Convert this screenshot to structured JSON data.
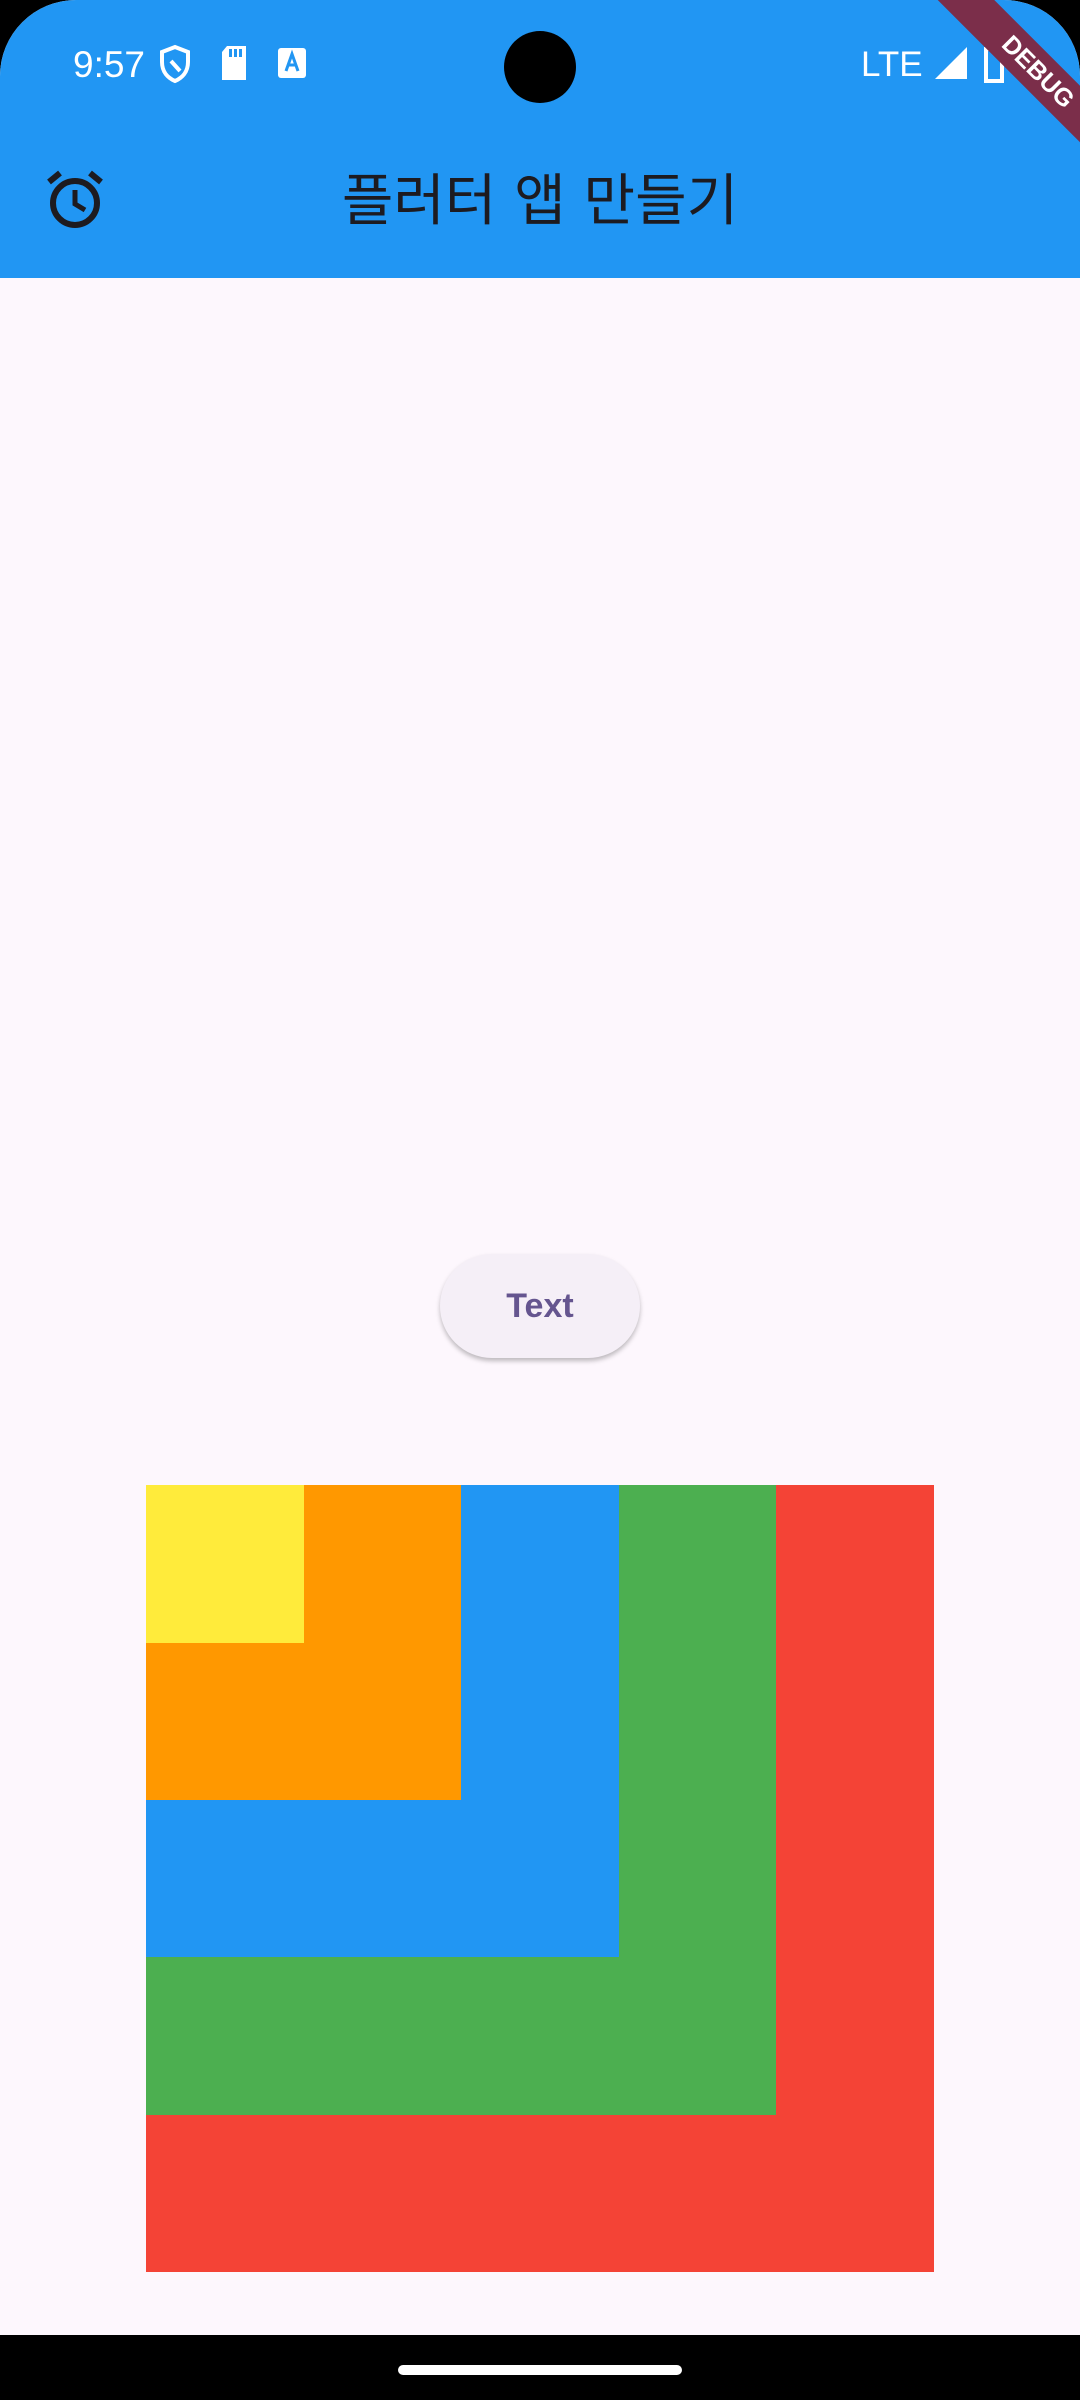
{
  "status_bar": {
    "time": "9:57",
    "network": "LTE",
    "icons": [
      "shield-icon",
      "sd-card-icon",
      "a-notification-icon",
      "signal-icon",
      "battery-icon"
    ]
  },
  "debug_banner": "DEBUG",
  "app_bar": {
    "title": "플러터 앱 만들기",
    "leading_icon": "alarm-icon",
    "color": "#2196f3"
  },
  "button": {
    "label": "Text",
    "text_color": "#65558f"
  },
  "nested_boxes": [
    {
      "name": "red",
      "color": "#f44336"
    },
    {
      "name": "green",
      "color": "#4caf50"
    },
    {
      "name": "blue",
      "color": "#2196f3"
    },
    {
      "name": "orange",
      "color": "#ff9800"
    },
    {
      "name": "yellow",
      "color": "#ffeb3b"
    }
  ]
}
